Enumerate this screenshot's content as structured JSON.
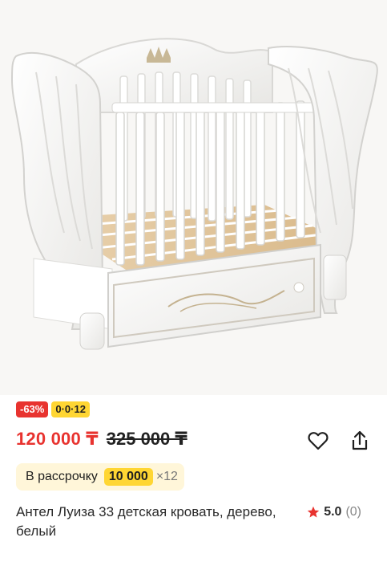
{
  "product": {
    "image_alt": "Crib product photo",
    "badges": {
      "discount": "-63%",
      "installment": "0·0·12"
    },
    "price": {
      "current": "120 000 ₸",
      "old": "325 000 ₸"
    },
    "installment": {
      "label": "В рассрочку",
      "amount": "10 000",
      "months": "×12"
    },
    "title": "Антел Луиза 33 детская кровать, дерево, белый",
    "rating": {
      "value": "5.0",
      "count": "(0)"
    }
  },
  "icons": {
    "favorite": "heart-icon",
    "share": "share-icon",
    "star": "star-icon"
  },
  "colors": {
    "price": "#e8332f",
    "discount_badge": "#e8332f",
    "installment_badge": "#ffd633",
    "installment_chip_bg": "#fff6d9",
    "star": "#e8332f"
  }
}
